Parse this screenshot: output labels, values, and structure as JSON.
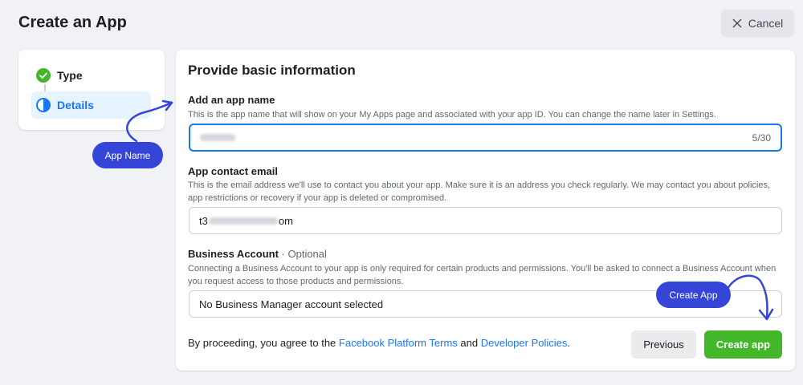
{
  "header": {
    "title": "Create an App",
    "cancel_label": "Cancel"
  },
  "steps": [
    {
      "label": "Type",
      "state": "complete"
    },
    {
      "label": "Details",
      "state": "current"
    }
  ],
  "form": {
    "heading": "Provide basic information",
    "app_name": {
      "label": "Add an app name",
      "description": "This is the app name that will show on your My Apps page and associated with your app ID. You can change the name later in Settings.",
      "counter": "5/30"
    },
    "contact_email": {
      "label": "App contact email",
      "description": "This is the email address we'll use to contact you about your app. Make sure it is an address you check regularly. We may contact you about policies, app restrictions or recovery if your app is deleted or compromised.",
      "value_prefix": "t3",
      "value_suffix": "om"
    },
    "business_account": {
      "label": "Business Account",
      "optional": " · Optional",
      "description": "Connecting a Business Account to your app is only required for certain products and permissions. You'll be asked to connect a Business Account when you request access to those products and permissions.",
      "selected": "No Business Manager account selected"
    },
    "terms": {
      "prefix": "By proceeding, you agree to the ",
      "platform_terms": "Facebook Platform Terms",
      "and": " and ",
      "developer_policies": "Developer Policies",
      "suffix": "."
    },
    "previous_label": "Previous",
    "create_label": "Create app"
  },
  "annotations": {
    "app_name_callout": "App Name",
    "create_app_callout": "Create App"
  },
  "colors": {
    "primary": "#1877f2",
    "success": "#42b72a",
    "callout": "#3545d8"
  }
}
